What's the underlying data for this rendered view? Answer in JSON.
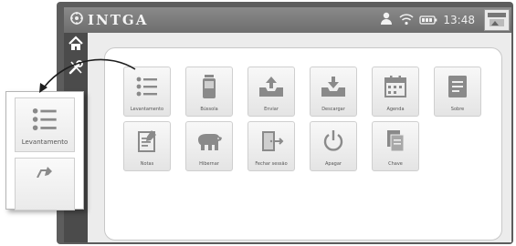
{
  "header": {
    "brand": "INTGA",
    "time": "13:48"
  },
  "status_icons": [
    "user-icon",
    "wifi-icon",
    "battery-icon"
  ],
  "sidebar": {
    "items": [
      {
        "icon": "home-icon"
      },
      {
        "icon": "tools-icon"
      }
    ]
  },
  "tiles": [
    {
      "label": "Levantamento",
      "icon": "list-icon"
    },
    {
      "label": "Bússola",
      "icon": "device-icon"
    },
    {
      "label": "Enviar",
      "icon": "upload-icon"
    },
    {
      "label": "Descargar",
      "icon": "download-icon"
    },
    {
      "label": "Agenda",
      "icon": "calendar-icon"
    },
    {
      "label": "Sobre",
      "icon": "document-icon"
    },
    {
      "label": "Notas",
      "icon": "notes-icon"
    },
    {
      "label": "Hibernar",
      "icon": "bear-icon"
    },
    {
      "label": "Fechar sessão",
      "icon": "logout-icon"
    },
    {
      "label": "Apagar",
      "icon": "power-icon"
    },
    {
      "label": "Chave",
      "icon": "files-icon"
    }
  ],
  "zoom_callout": {
    "label": "Levantamento"
  },
  "colors": {
    "topbar": "#7b7b7b",
    "sidebar": "#4b4b4b",
    "tile_icon": "#8a8a8a"
  }
}
